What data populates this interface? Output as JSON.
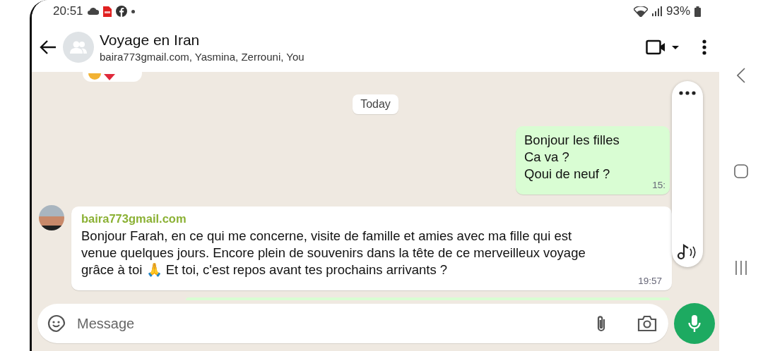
{
  "status_bar": {
    "time": "20:51",
    "battery": "93%"
  },
  "header": {
    "title": "Voyage en Iran",
    "subtitle": "baira773gmail.com, Yasmina, Zerrouni, You"
  },
  "date_chip": "Today",
  "messages": [
    {
      "kind": "outgoing",
      "text": "Bonjour les filles\nCa va ?\nQoui de neuf ?",
      "time": "15:"
    },
    {
      "kind": "incoming",
      "sender": "baira773gmail.com",
      "text": "Bonjour Farah, en ce qui me concerne, visite de famille et amies avec ma fille qui est venue quelques jours. Encore plein de souvenirs dans la tête de ce merveilleux voyage grâce à toi 🙏 Et toi, c'est repos avant tes prochains arrivants ?",
      "time": "19:57"
    }
  ],
  "composer": {
    "placeholder": "Message"
  }
}
